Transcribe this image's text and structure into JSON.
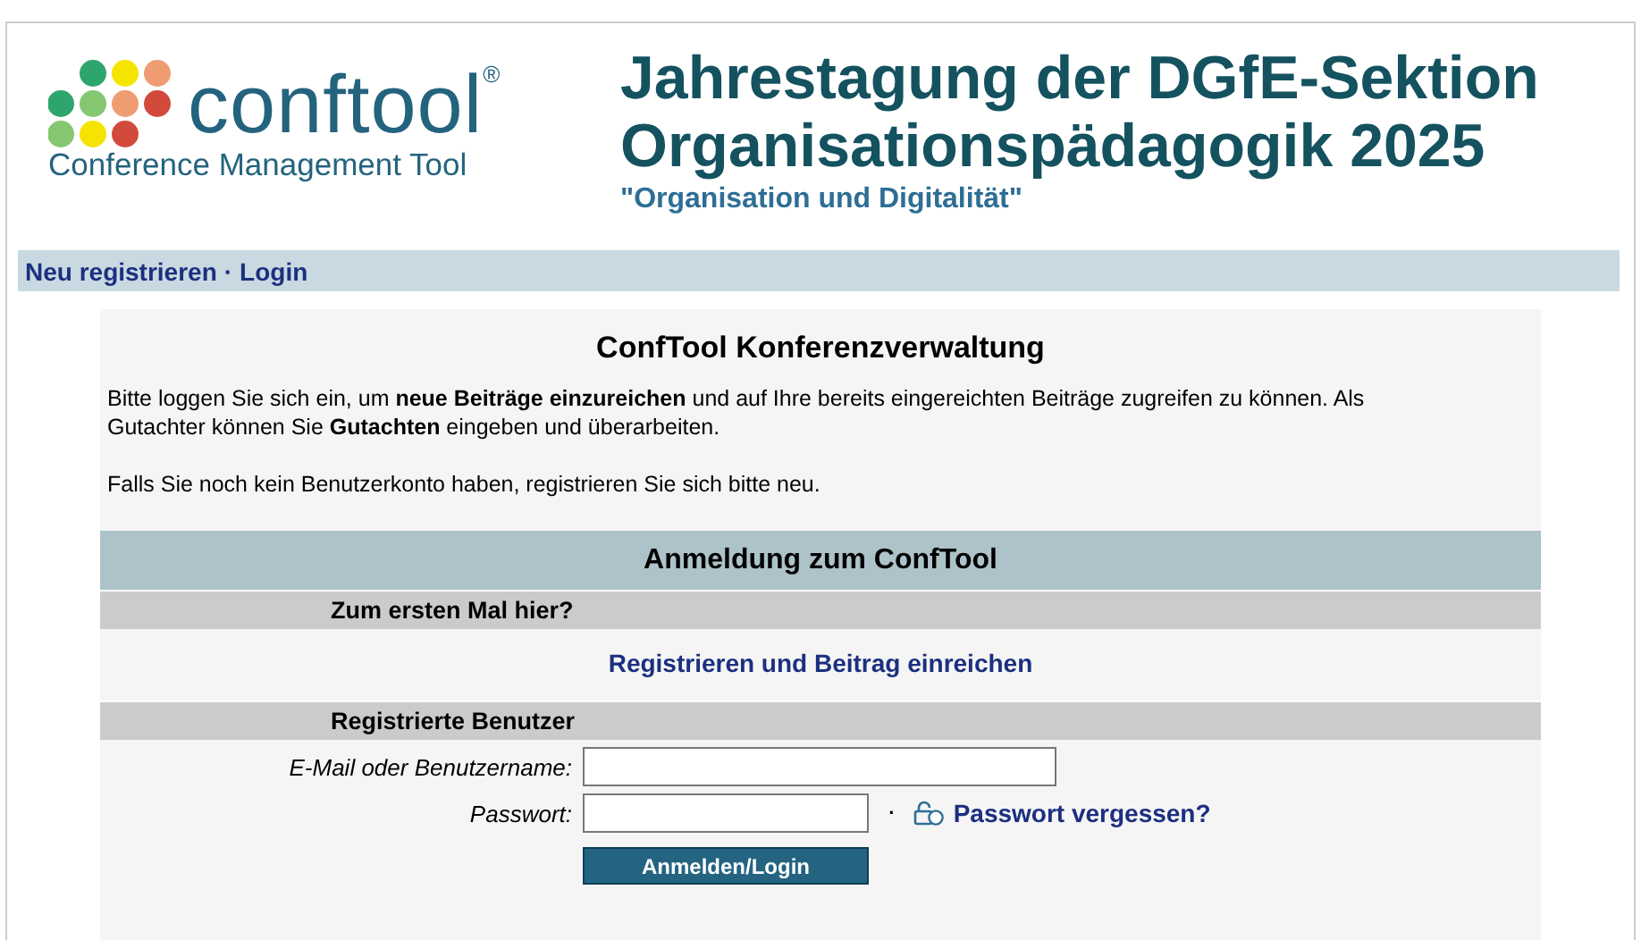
{
  "logo": {
    "wordmark": "conftool$^{®}$",
    "tagline": "Conference Management Tool"
  },
  "header": {
    "title_line_1": "Jahrestagung der DGfE-Sektion",
    "title_line_2": "Organisationspädagogik 2025",
    "subtitle": "\"Organisation und Digitalität\""
  },
  "nav": {
    "items": [
      "Neu registrieren",
      "Login"
    ],
    "separator": "·"
  },
  "intro": {
    "heading": "ConfTool Konferenzverwaltung",
    "paragraphs": [
      "Bitte loggen Sie sich ein, um **neue Beiträge einzureichen** und auf Ihre bereits eingereichten Beiträge zugreifen zu können. Als Gutachter können Sie **Gutachten** eingeben und überarbeiten.",
      "Falls Sie noch kein Benutzerkonto haben, registrieren Sie sich bitte neu."
    ]
  },
  "login": {
    "title": "Anmeldung zum ConfTool",
    "first_time_heading": "Zum ersten Mal hier?",
    "register_link": "Registrieren und Beitrag einreichen",
    "registered_heading": "Registrierte Benutzer",
    "email_label": "E-Mail oder Benutzername:",
    "password_label": "Passwort:",
    "separator": "·",
    "forgot_link": "Passwort vergessen?",
    "submit": "Anmelden/Login"
  }
}
